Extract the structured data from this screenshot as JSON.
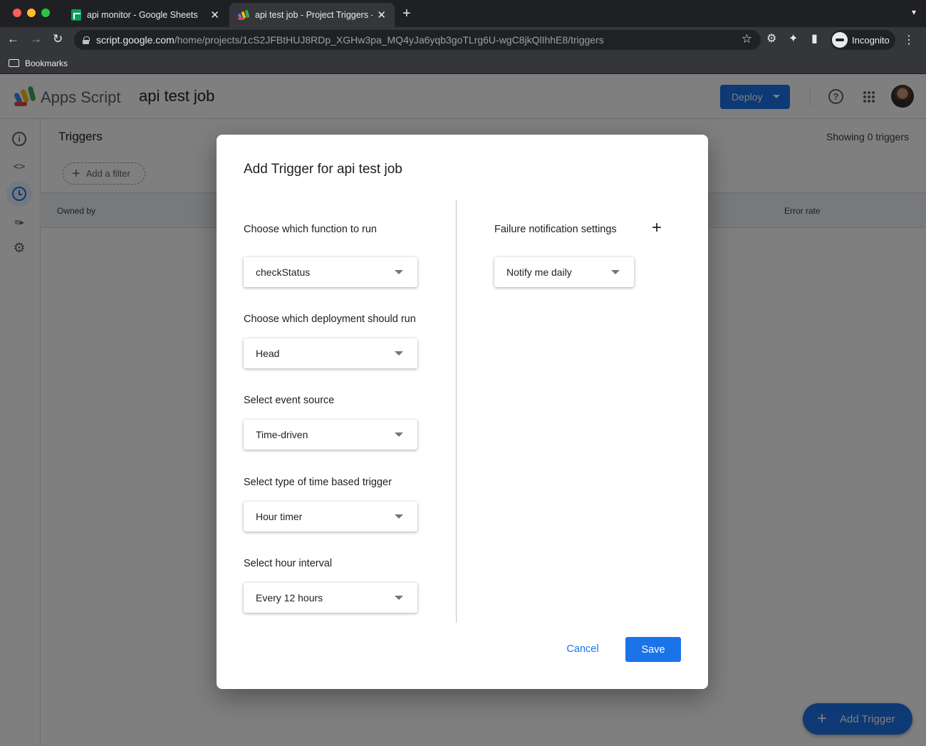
{
  "browser": {
    "tabs": [
      {
        "title": "api monitor - Google Sheets",
        "favicon": "google-sheets-icon",
        "active": false
      },
      {
        "title": "api test job - Project Triggers -",
        "favicon": "apps-script-icon",
        "active": true
      }
    ],
    "url_host": "script.google.com",
    "url_path": "/home/projects/1cS2JFBtHUJ8RDp_XGHw3pa_MQ4yJa6yqb3goTLrg6U-wgC8jkQlIhhE8/triggers",
    "incognito_label": "Incognito",
    "bookmarks_label": "Bookmarks"
  },
  "header": {
    "app_name": "Apps Script",
    "project_name": "api test job",
    "deploy_label": "Deploy",
    "help_icon": "?"
  },
  "sidebar": {
    "items": [
      {
        "name": "overview",
        "icon": "info-icon",
        "glyph": "i"
      },
      {
        "name": "editor",
        "icon": "code-icon",
        "glyph": "<>"
      },
      {
        "name": "triggers",
        "icon": "clock-icon",
        "active": true
      },
      {
        "name": "executions",
        "icon": "executions-icon",
        "glyph": "≡▸"
      },
      {
        "name": "settings",
        "icon": "gear-icon",
        "glyph": "⚙"
      }
    ]
  },
  "triggers_page": {
    "title": "Triggers",
    "showing": "Showing 0 triggers",
    "add_filter": "Add a filter",
    "columns": {
      "owned_by": "Owned by",
      "error_rate": "Error rate"
    },
    "fab_label": "Add Trigger"
  },
  "dialog": {
    "title": "Add Trigger for api test job",
    "function_label": "Choose which function to run",
    "function_value": "checkStatus",
    "deployment_label": "Choose which deployment should run",
    "deployment_value": "Head",
    "event_source_label": "Select event source",
    "event_source_value": "Time-driven",
    "trigger_type_label": "Select type of time based trigger",
    "trigger_type_value": "Hour timer",
    "interval_label": "Select hour interval",
    "interval_value": "Every 12 hours",
    "failure_label": "Failure notification settings",
    "failure_value": "Notify me daily",
    "cancel_label": "Cancel",
    "save_label": "Save"
  },
  "colors": {
    "accent": "#1a73e8",
    "scrim": "rgba(0,0,0,0.5)",
    "chrome_dark": "#35363a"
  }
}
